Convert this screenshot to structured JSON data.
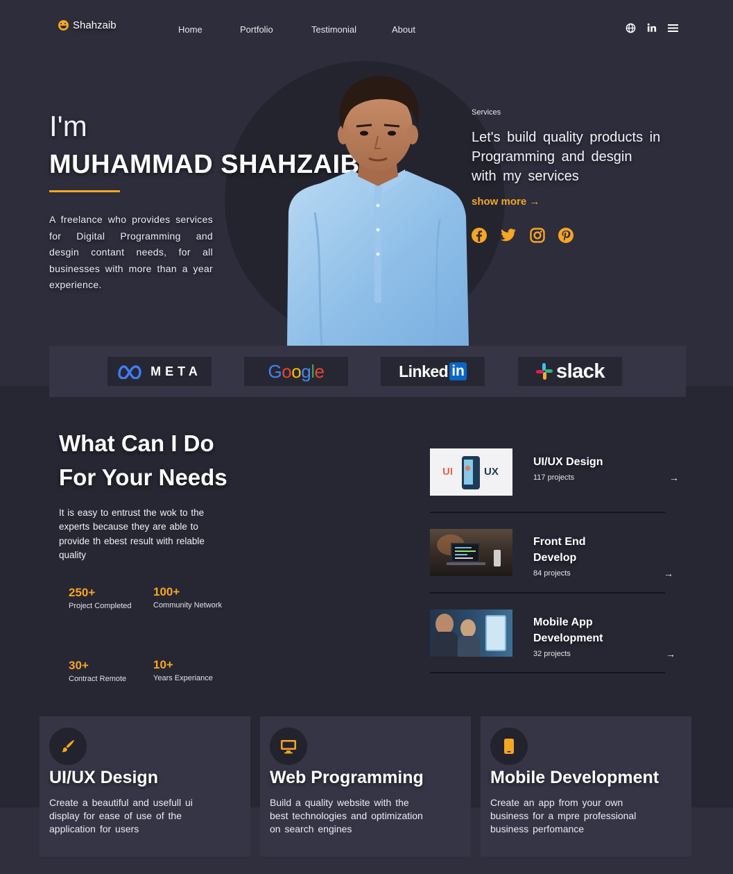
{
  "nav": {
    "logo": "Shahzaib",
    "links": [
      "Home",
      "Portfolio",
      "Testimonial",
      "About"
    ],
    "icons": [
      "globe-icon",
      "linkedin-icon",
      "menu-icon"
    ]
  },
  "hero": {
    "greeting": "I'm",
    "name": "MUHAMMAD SHAHZAIB",
    "bio": "A freelance who provides services for Digital Programming and desgin contant needs, for all businesses with more than a year experience.",
    "services_label": "Services",
    "services_heading": "Let's build quality products in Programming and desgin with my services",
    "show_more": "show more →",
    "social_icons": [
      "facebook-icon",
      "twitter-icon",
      "instagram-icon",
      "pinterest-icon"
    ]
  },
  "brands": [
    "META",
    "Google",
    "LinkedIn",
    "slack"
  ],
  "about": {
    "title_line1": "What Can I Do",
    "title_line2": "For Your Needs",
    "description": "It is easy to entrust the wok to the experts because they are able to provide th ebest result with relable quality",
    "stats": [
      {
        "value": "250+",
        "label": "Project Completed"
      },
      {
        "value": "100+",
        "label": "Community Network"
      },
      {
        "value": "30+",
        "label": "Contract Remote"
      },
      {
        "value": "10+",
        "label": "Years Experiance"
      }
    ]
  },
  "service_list": [
    {
      "title": "UI/UX Design",
      "count": "117 projects",
      "thumb_left": "UI",
      "thumb_right": "UX"
    },
    {
      "title": "Front End Develop",
      "count": "84 projects"
    },
    {
      "title": "Mobile App Development",
      "count": "32 projects"
    }
  ],
  "arrow": "→",
  "cards": [
    {
      "title": "UI/UX Design",
      "description": "Create a beautiful and usefull ui display for ease of use of the application for users",
      "icon": "paintbrush-icon"
    },
    {
      "title": "Web Programming",
      "description": "Build a quality website with the best technologies and optimization on search engines",
      "icon": "monitor-icon"
    },
    {
      "title": "Mobile Development",
      "description": "Create an app from your own business for a mpre professional business perfomance",
      "icon": "mobile-icon"
    }
  ],
  "colors": {
    "accent": "#f5a623",
    "background": "#272733",
    "panel": "#353546"
  }
}
